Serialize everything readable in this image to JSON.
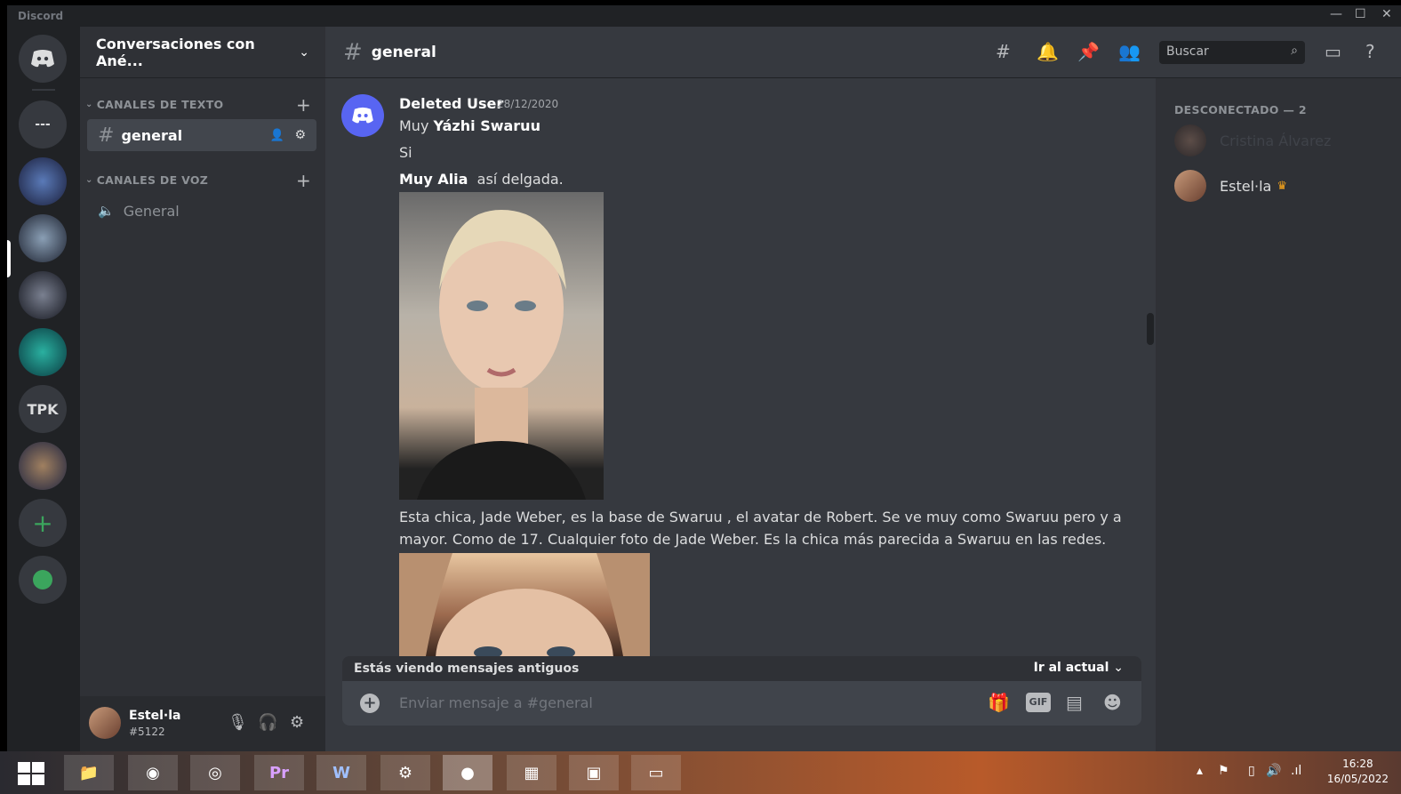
{
  "app": {
    "title": "Discord"
  },
  "server": {
    "name": "Conversaciones con Ané..."
  },
  "guilds": [
    {
      "name": "home",
      "label": ""
    },
    {
      "name": "server-dm",
      "label": "---"
    },
    {
      "name": "server-2",
      "label": ""
    },
    {
      "name": "server-3",
      "label": ""
    },
    {
      "name": "server-4",
      "label": ""
    },
    {
      "name": "server-5",
      "label": ""
    },
    {
      "name": "server-tpk",
      "label": "TPK"
    },
    {
      "name": "server-7",
      "label": ""
    }
  ],
  "categories": {
    "text": "CANALES DE TEXTO",
    "voice": "CANALES DE VOZ"
  },
  "channels": {
    "text": [
      {
        "name": "general"
      }
    ],
    "voice": [
      {
        "name": "General"
      }
    ]
  },
  "chat": {
    "channel": "general",
    "search_placeholder": "Buscar",
    "message": {
      "author": "Deleted User",
      "timestamp": "28/12/2020",
      "line1_prefix": "Muy",
      "line1_bold": "Yázhi Swaruu",
      "line2": "Si",
      "line3_bold": "Muy Alia",
      "line3_rest": "así delgada.",
      "line4": "Esta chica, Jade Weber,  es la base de Swaruu , el avatar de Robert.  Se ve muy como Swaruu pero y a",
      "line5": "mayor. Como de 17.   Cualquier foto de Jade Weber. Es la chica más parecida a Swaruu en las redes."
    },
    "old_messages_banner": "Estás viendo mensajes antiguos",
    "jump_present": "Ir al actual",
    "composer_placeholder": "Enviar mensaje a #general",
    "gif_label": "GIF"
  },
  "members": {
    "header": "DESCONECTADO — 2",
    "list": [
      {
        "name": "Cristina Álvarez",
        "color": "#4f545c"
      },
      {
        "name": "Estel·la",
        "color": "#dcddde"
      }
    ]
  },
  "user": {
    "name": "Estel·la",
    "discriminator": "#5122"
  },
  "taskbar": {
    "apps": [
      "Pr",
      "W"
    ],
    "time": "16:28",
    "date": "16/05/2022"
  }
}
